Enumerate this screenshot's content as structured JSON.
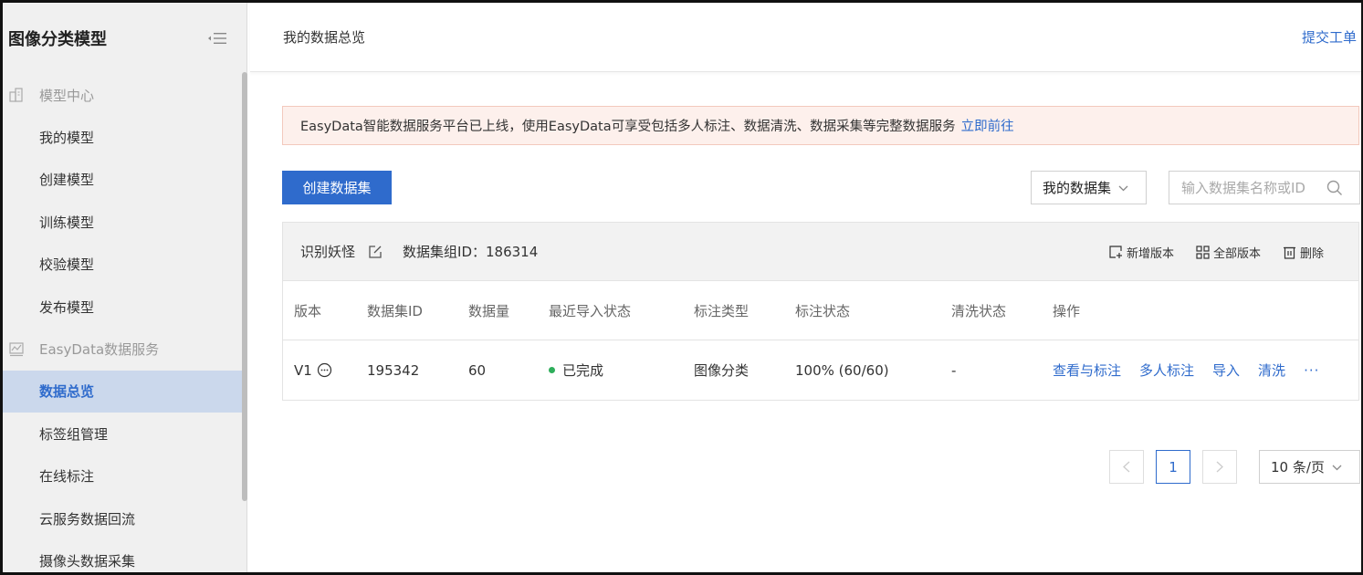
{
  "app": {
    "title": "图像分类模型",
    "page_title": "我的数据总览",
    "ticket_link": "提交工单"
  },
  "sidebar": {
    "groups": [
      {
        "label": "模型中心",
        "icon": "model-center-icon",
        "items": [
          "我的模型",
          "创建模型",
          "训练模型",
          "校验模型",
          "发布模型"
        ]
      },
      {
        "label": "EasyData数据服务",
        "icon": "data-service-icon",
        "items": [
          "数据总览",
          "标签组管理",
          "在线标注",
          "云服务数据回流",
          "摄像头数据采集"
        ]
      }
    ],
    "active_item": "数据总览"
  },
  "banner": {
    "text": "EasyData智能数据服务平台已上线，使用EasyData可享受包括多人标注、数据清洗、数据采集等完整数据服务",
    "link": "立即前往"
  },
  "toolbar": {
    "create_button": "创建数据集",
    "dataset_filter": "我的数据集",
    "search_placeholder": "输入数据集名称或ID"
  },
  "dataset": {
    "name": "识别妖怪",
    "group_id_label": "数据集组ID：186314",
    "actions": [
      "新增版本",
      "全部版本",
      "删除"
    ],
    "columns": [
      "版本",
      "数据集ID",
      "数据量",
      "最近导入状态",
      "标注类型",
      "标注状态",
      "清洗状态",
      "操作"
    ],
    "rows": [
      {
        "version": "V1",
        "dataset_id": "195342",
        "count": "60",
        "import_status": "已完成",
        "import_status_color": "#2eae5b",
        "label_type": "图像分类",
        "label_status": "100% (60/60)",
        "clean_status": "-",
        "operations": [
          "查看与标注",
          "多人标注",
          "导入",
          "清洗"
        ],
        "more": "···"
      }
    ]
  },
  "pagination": {
    "current_page": "1",
    "page_size": "10 条/页"
  },
  "colors": {
    "accent": "#2f6bcc",
    "active_bg": "#cbd8ec",
    "banner_bg": "#fdf0ec",
    "success": "#2eae5b"
  }
}
